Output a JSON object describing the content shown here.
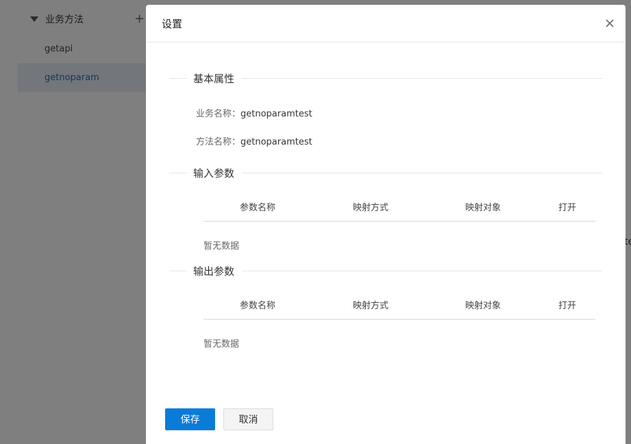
{
  "background": {
    "tree": {
      "group_label": "业务方法",
      "add_symbol": "+",
      "items": [
        {
          "label": "getapi",
          "active": false
        },
        {
          "label": "getnoparam",
          "active": true
        }
      ]
    },
    "edge_text": "te"
  },
  "modal": {
    "title": "设置",
    "basic": {
      "section_title": "基本属性",
      "business_name_label": "业务名称：",
      "business_name_value": "getnoparamtest",
      "method_name_label": "方法名称：",
      "method_name_value": "getnoparamtest"
    },
    "input_params": {
      "section_title": "输入参数",
      "columns": [
        "参数名称",
        "映射方式",
        "映射对象",
        "打开"
      ],
      "empty_text": "暂无数据"
    },
    "output_params": {
      "section_title": "输出参数",
      "columns": [
        "参数名称",
        "映射方式",
        "映射对象",
        "打开"
      ],
      "empty_text": "暂无数据"
    },
    "buttons": {
      "save": "保存",
      "cancel": "取消"
    }
  },
  "colors": {
    "primary": "#0b7bd8",
    "active_bg": "#e6edf7",
    "active_text": "#2d6cb5"
  }
}
